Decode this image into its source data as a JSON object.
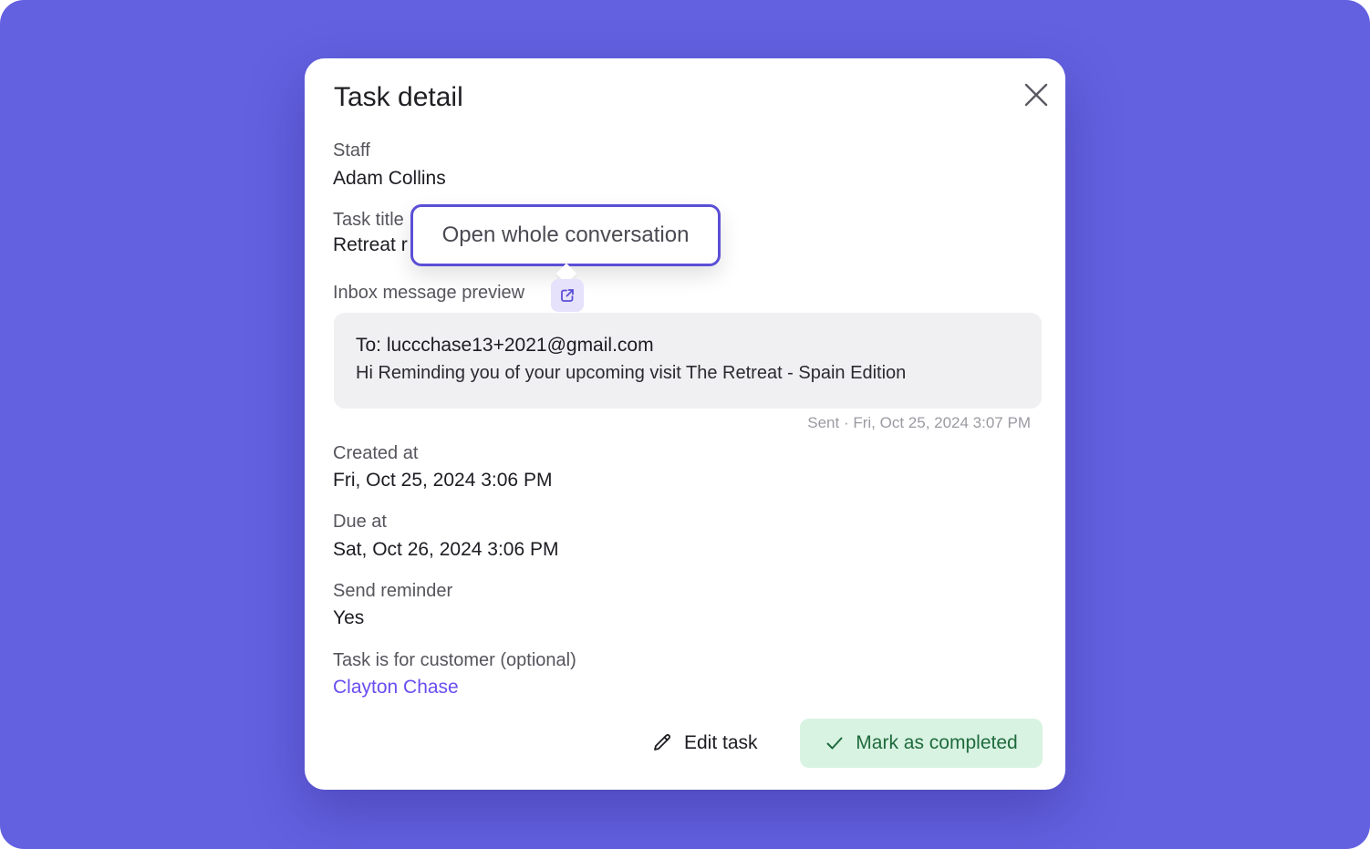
{
  "modal": {
    "title": "Task detail"
  },
  "tooltip": {
    "text": "Open whole conversation"
  },
  "fields": {
    "staff": {
      "label": "Staff",
      "value": "Adam Collins"
    },
    "task_title": {
      "label": "Task title",
      "value": "Retreat r"
    },
    "inbox_preview": {
      "label": "Inbox message preview"
    },
    "created_at": {
      "label": "Created at",
      "value": "Fri, Oct 25, 2024 3:06 PM"
    },
    "due_at": {
      "label": "Due at",
      "value": "Sat, Oct 26, 2024 3:06 PM"
    },
    "send_reminder": {
      "label": "Send reminder",
      "value": "Yes"
    },
    "customer": {
      "label": "Task is for customer (optional)",
      "value": "Clayton Chase"
    }
  },
  "message": {
    "to": "To: luccchase13+2021@gmail.com",
    "body": "Hi Reminding you of your upcoming visit The Retreat - Spain Edition",
    "sent": "Sent · Fri, Oct 25, 2024 3:07 PM"
  },
  "actions": {
    "edit_label": "Edit task",
    "complete_label": "Mark as completed"
  },
  "colors": {
    "backdrop": "#6361e0",
    "accent": "#6a4df0",
    "tooltip_border": "#5b4fd6",
    "success_bg": "#d8f3e2",
    "success_text": "#1f6a3c"
  },
  "icons": {
    "close": "close-icon",
    "external_link": "external-link-icon",
    "edit": "pencil-icon",
    "complete": "check-icon"
  }
}
